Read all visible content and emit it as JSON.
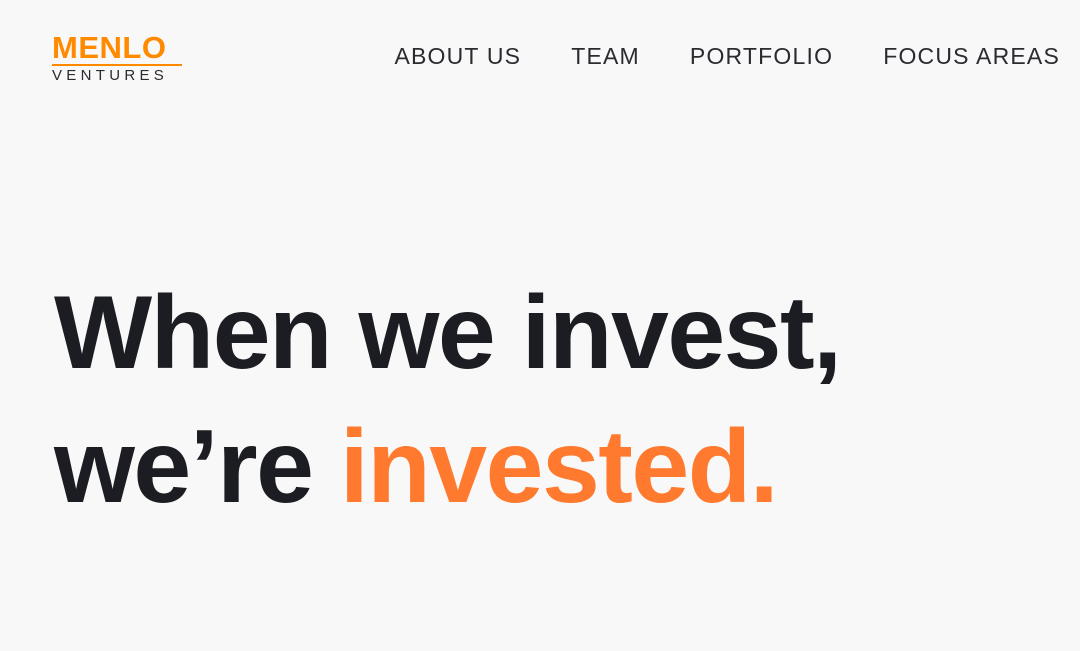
{
  "colors": {
    "background": "#f8f8f8",
    "text": "#1c1d22",
    "brand_orange": "#ff8a00",
    "accent_orange": "#ff7a2f"
  },
  "logo": {
    "top": "MENLO",
    "bottom": "VENTURES"
  },
  "nav": {
    "items": [
      {
        "label": "ABOUT US"
      },
      {
        "label": "TEAM"
      },
      {
        "label": "PORTFOLIO"
      },
      {
        "label": "FOCUS AREAS"
      }
    ]
  },
  "hero": {
    "line1": "When we invest,",
    "line2_prefix": "we’re ",
    "line2_accent": "invested."
  }
}
